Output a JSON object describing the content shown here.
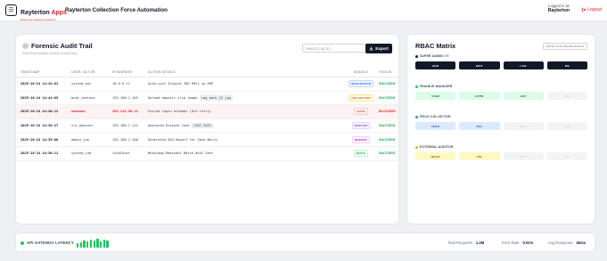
{
  "header": {
    "brand_primary": "Rayterton",
    "brand_accent": "Apps",
    "brand_tagline": "Enterprise Software Solutions",
    "app_title": "Rayterton Collection Force Automation",
    "logged_label": "Logged in as",
    "logged_user": "Rayterton",
    "logout_label": "Logout"
  },
  "audit": {
    "title": "Forensic Audit Trail",
    "subtitle": "Real-time system activity monitoring",
    "search_placeholder": "Search Log ID...",
    "export_label": "Export",
    "columns": [
      "TIMESTAMP",
      "USER / ACTOR",
      "IP ADDRESS",
      "ACTION DETAILS",
      "MODULE",
      "STATUS"
    ],
    "rows": [
      {
        "timestamp": "2025-10-24 14:42:01",
        "user": "system_bot",
        "ip": "10.0.0.12",
        "action": "Auto-sync Invoice INV-9921 to ERP",
        "code": "",
        "module": "INTEGRATION",
        "status": "SUCCESS",
        "blocked": false
      },
      {
        "timestamp": "2025-10-24 14:41:05",
        "user": "budi_santoso",
        "ip": "192.168.1.105",
        "action": "Upload deposit slip image",
        "code": "img_bank_22.jpg",
        "module": "COLLECTION",
        "status": "SUCCESS",
        "blocked": false
      },
      {
        "timestamp": "2025-10-24 14:40:12",
        "user": "unknown",
        "ip": "203.112.90.11",
        "action": "Failed login attempt (3rd retry)",
        "code": "",
        "module": "AUTH",
        "status": "BLOCKED",
        "blocked": true
      },
      {
        "timestamp": "2025-10-24 14:38:27",
        "user": "sri_wahyuni",
        "ip": "192.168.1.112",
        "action": "Approved Dispute Case",
        "code": "CASE-2283",
        "module": "DISPUTE",
        "status": "SUCCESS",
        "blocked": false
      },
      {
        "timestamp": "2025-10-24 14:35:00",
        "user": "admin_joe",
        "ip": "192.168.1.100",
        "action": "Generated DSO Report for Zone North",
        "code": "",
        "module": "REPORT",
        "status": "SUCCESS",
        "blocked": false
      },
      {
        "timestamp": "2025-10-24 14:30:11",
        "user": "system_job",
        "ip": "localhost",
        "action": "WhatsApp Reminder Batch #442 Sent",
        "code": "",
        "module": "NOTIF",
        "status": "SUCCESS",
        "blocked": false
      }
    ]
  },
  "rbac": {
    "title": "RBAC Matrix",
    "badge": "EFFECTIVE PERMISSIONS",
    "roles": [
      {
        "name": "SUPER ADMIN / IT",
        "dot": "#111827",
        "perms": [
          {
            "label": "ADD",
            "on": true
          },
          {
            "label": "EDIT",
            "on": true
          },
          {
            "label": "LOG",
            "on": true
          },
          {
            "label": "DB",
            "on": true
          }
        ]
      },
      {
        "name": "FINANCE MANAGER",
        "dot": "#22c55e",
        "perms": [
          {
            "label": "VIEW",
            "on": true
          },
          {
            "label": "APPR",
            "on": true
          },
          {
            "label": "EXP",
            "on": true
          },
          {
            "label": "DEL",
            "on": false
          }
        ]
      },
      {
        "name": "FIELD COLLECTOR",
        "dot": "#3b82f6",
        "perms": [
          {
            "label": "TASK",
            "on": true
          },
          {
            "label": "PAY",
            "on": true
          },
          {
            "label": "EDIT",
            "on": false
          },
          {
            "label": "DEL",
            "on": false
          }
        ]
      },
      {
        "name": "EXTERNAL AUDITOR",
        "dot": "#eab308",
        "perms": [
          {
            "label": "READ",
            "on": true
          },
          {
            "label": "TRL",
            "on": true
          },
          {
            "label": "EDIT",
            "on": false
          },
          {
            "label": "DEL",
            "on": false
          }
        ]
      }
    ]
  },
  "footer": {
    "gateway_label": "API GATEWAY LATENCY",
    "latency_bars": [
      0.45,
      0.55,
      0.75,
      0.6,
      0.85,
      0.7,
      0.9,
      0.65,
      0.8,
      0.7
    ],
    "total_requests_label": "Total Requests:",
    "total_requests_value": "1.2M",
    "error_rate_label": "Error Rate:",
    "error_rate_value": "0.01%",
    "avg_response_label": "Avg Response:",
    "avg_response_value": "45ms"
  },
  "colors": {
    "accent": "#dc2626",
    "success": "#16a34a",
    "blocked": "#dc2626",
    "dark": "#111827"
  },
  "module_colors": {
    "INTEGRATION": [
      "#eff6ff",
      "#2563eb",
      "#bfdbfe"
    ],
    "COLLECTION": [
      "#fefce8",
      "#b45309",
      "#fde68a"
    ],
    "AUTH": [
      "#fef2f2",
      "#dc2626",
      "#fecaca"
    ],
    "DISPUTE": [
      "#f5f3ff",
      "#7c3aed",
      "#ddd6fe"
    ],
    "REPORT": [
      "#fdf4ff",
      "#a21caf",
      "#f5d0fe"
    ],
    "NOTIF": [
      "#f0fdf4",
      "#16a34a",
      "#bbf7d0"
    ]
  },
  "role_colors": {
    "SUPER ADMIN / IT": [
      "#111827",
      "#ffffff"
    ],
    "FINANCE MANAGER": [
      "#dcfce7",
      "#166534"
    ],
    "FIELD COLLECTOR": [
      "#dbeafe",
      "#1e40af"
    ],
    "EXTERNAL AUDITOR": [
      "#fef9c3",
      "#854d0e"
    ]
  }
}
